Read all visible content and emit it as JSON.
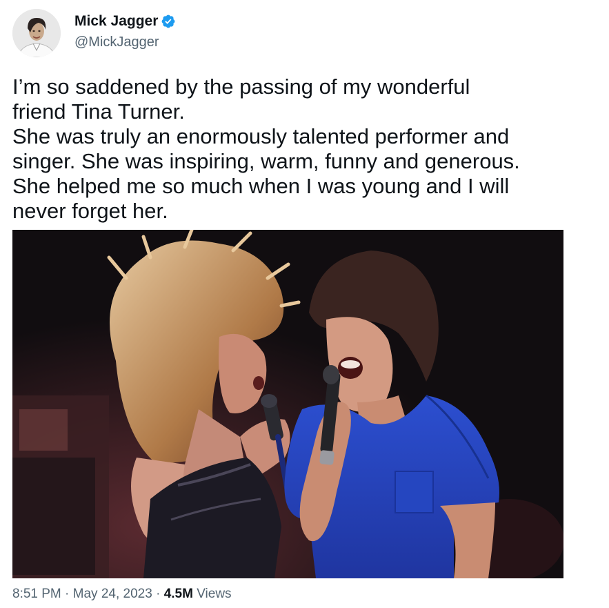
{
  "author": {
    "display_name": "Mick Jagger",
    "handle": "@MickJagger",
    "verified": true,
    "avatar_icon": "avatar-photo-icon",
    "verified_icon": "verified-badge-icon",
    "verified_color": "#1d9bf0"
  },
  "tweet": {
    "lines": [
      "I’m so saddened by the passing of my wonderful",
      "friend Tina Turner.",
      "She was truly an enormously talented performer and",
      "singer. She was inspiring, warm, funny and generous.",
      "She helped me so much when I was young and I will",
      "never forget her."
    ]
  },
  "media": {
    "kind": "photo"
  },
  "meta": {
    "time": "8:51 PM",
    "separator": "·",
    "date": "May 24, 2023",
    "views_count": "4.5M",
    "views_label": "Views"
  },
  "colors": {
    "text_primary": "#0f1419",
    "text_secondary": "#536471",
    "background": "#ffffff"
  }
}
